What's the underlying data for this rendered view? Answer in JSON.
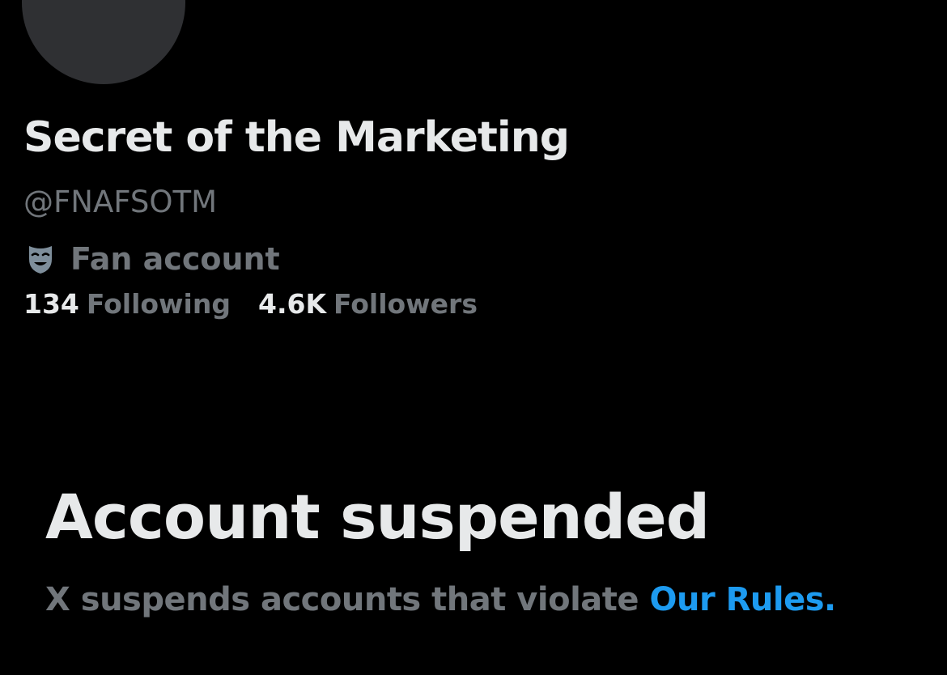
{
  "profile": {
    "display_name": "Secret of the Marketing",
    "handle": "@FNAFSOTM",
    "category": {
      "icon": "theater-masks-icon",
      "label": "Fan account"
    },
    "stats": {
      "following_count": "134",
      "following_label": "Following",
      "followers_count": "4.6K",
      "followers_label": "Followers"
    }
  },
  "suspension": {
    "title": "Account suspended",
    "description": "X suspends accounts that violate",
    "link_label": "Our Rules",
    "trailing": "."
  },
  "colors": {
    "background": "#000000",
    "primary_text": "#e7e9ea",
    "secondary_text": "#71767b",
    "link": "#1d9bf0",
    "avatar_placeholder": "#2f3033"
  }
}
